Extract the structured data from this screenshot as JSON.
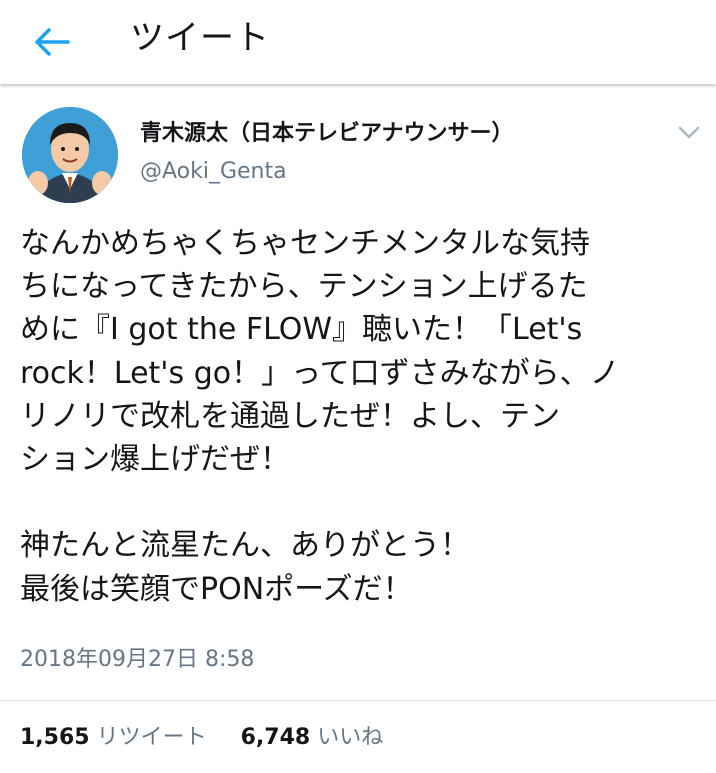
{
  "header": {
    "title": "ツイート",
    "back_icon": "back-arrow-icon"
  },
  "colors": {
    "accent": "#1da1f2",
    "text": "#14171a",
    "secondary": "#657786"
  },
  "tweet": {
    "display_name": "青木源太（日本テレビアナウンサー）",
    "handle": "@Aoki_Genta",
    "menu_icon": "chevron-down-icon",
    "lines": [
      "なんかめちゃくちゃセンチメンタルな気持",
      "ちになってきたから、テンション上げるた",
      "めに『I got the FLOW』聴いた！「Let's",
      "rock！Let's go！」って口ずさみながら、ノ",
      "リノリで改札を通過したぜ！よし、テン",
      "ション爆上げだぜ！",
      "",
      "神たんと流星たん、ありがとう！",
      "最後は笑顔でPONポーズだ！"
    ],
    "timestamp": "2018年09月27日 8:58",
    "retweet_count": "1,565",
    "retweet_label": "リツイート",
    "like_count": "6,748",
    "like_label": "いいね"
  }
}
